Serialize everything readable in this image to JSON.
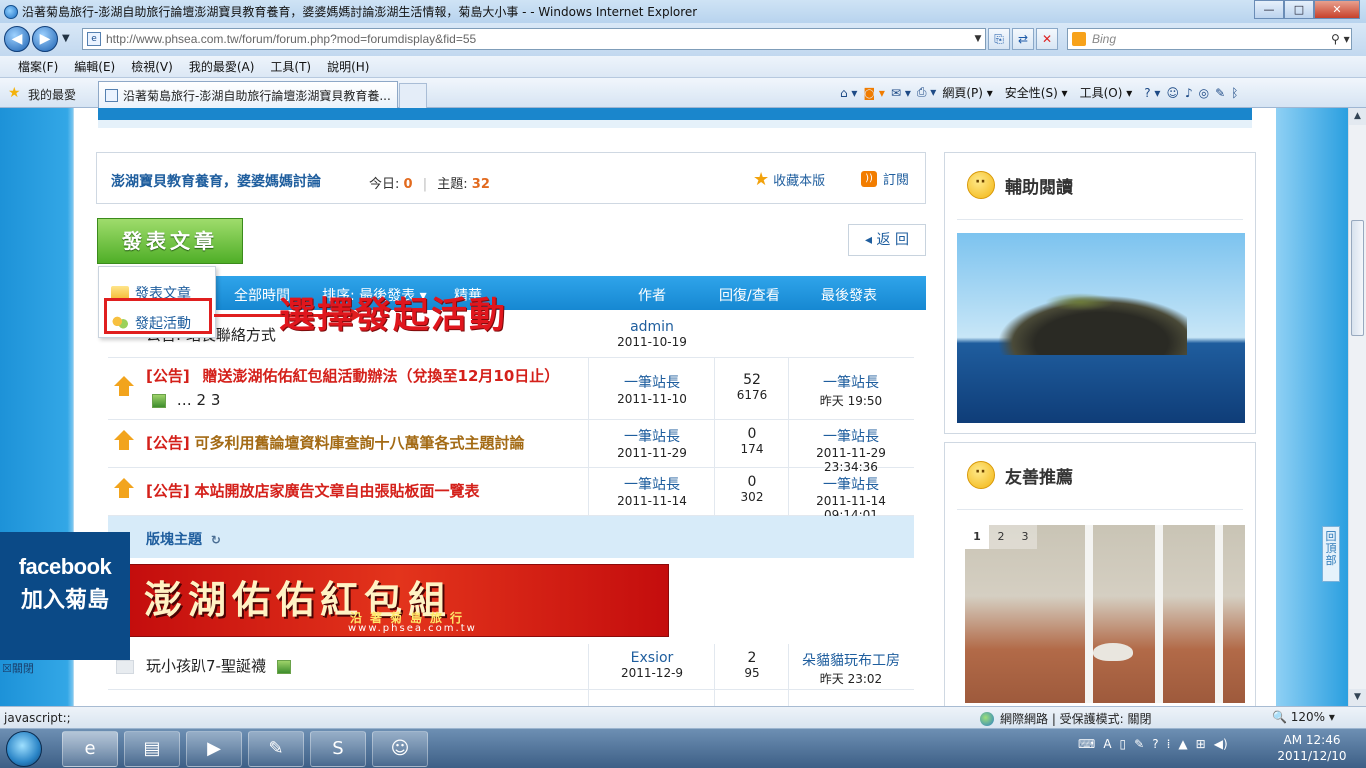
{
  "window": {
    "title": "沿著菊島旅行-澎湖自助旅行論壇澎湖寶貝教育養育，婆婆媽媽討論澎湖生活情報，菊島大小事 - - Windows Internet Explorer",
    "minimize": "—",
    "maximize": "□",
    "close": "✕"
  },
  "address": {
    "url": "http://www.phsea.com.tw/forum/forum.php?mod=forumdisplay&fid=55",
    "search_placeholder": "Bing"
  },
  "menu": [
    "檔案(F)",
    "編輯(E)",
    "檢視(V)",
    "我的最愛(A)",
    "工具(T)",
    "說明(H)"
  ],
  "favbar": {
    "favorites_label": "我的最愛",
    "tab_title": "沿著菊島旅行-澎湖自助旅行論壇澎湖寶貝教育養...",
    "commands": [
      "網頁(P) ▾",
      "安全性(S) ▾",
      "工具(O) ▾"
    ]
  },
  "forum": {
    "title": "澎湖寶貝教育養育，婆婆媽媽討論",
    "today_label": "今日:",
    "today_value": "0",
    "topics_label": "主題:",
    "topics_value": "32",
    "favorite_label": "收藏本版",
    "subscribe_label": "訂閱",
    "post_button": "發表文章",
    "back_button": "◂ 返 回"
  },
  "dropdown": {
    "item1": "發表文章",
    "item2": "發起活動"
  },
  "annotation": "選擇發起活動",
  "table_header": {
    "time": "全部時間",
    "sort": "排序: 最後發表 ▾",
    "digest": "精華",
    "author": "作者",
    "replies": "回復/查看",
    "last": "最後發表"
  },
  "rows": {
    "r0": {
      "title": "公告: 站長聯絡方式",
      "author": "admin",
      "date": "2011-10-19"
    },
    "r1": {
      "tag": "[公告]",
      "title": "贈送澎湖佑佑紅包組活動辦法（兌換至12月10日止）",
      "pages": "… 2  3",
      "author": "一筆站長",
      "date": "2011-11-10",
      "replies": "52",
      "views": "6176",
      "last_user": "一筆站長",
      "last_time": "昨天 19:50"
    },
    "r2": {
      "tag": "[公告]",
      "title": "可多利用舊論壇資料庫查詢十八萬筆各式主題討論",
      "author": "一筆站長",
      "date": "2011-11-29",
      "replies": "0",
      "views": "174",
      "last_user": "一筆站長",
      "last_time": "2011-11-29 23:34:36"
    },
    "r3": {
      "tag": "[公告]",
      "title": "本站開放店家廣告文章自由張貼板面一覽表",
      "author": "一筆站長",
      "date": "2011-11-14",
      "replies": "0",
      "views": "302",
      "last_user": "一筆站長",
      "last_time": "2011-11-14 09:14:01"
    },
    "r4": {
      "title": "玩小孩趴7-聖誕襪",
      "author": "Exsior",
      "date": "2011-12-9",
      "replies": "2",
      "views": "95",
      "last_user": "朵貓貓玩布工房",
      "last_time": "昨天 23:02"
    }
  },
  "section": {
    "title": "版塊主題"
  },
  "banner": {
    "main": "澎湖佑佑紅包組",
    "sub": "沿著菊島旅行",
    "url": "www.phsea.com.tw"
  },
  "sidebar": {
    "reading_title": "輔助閱讀",
    "recommend_title": "友善推薦",
    "pager": [
      "1",
      "2",
      "3"
    ]
  },
  "facebook": {
    "logo": "facebook",
    "join": "加入菊島",
    "close": "☒關閉"
  },
  "back_to_top": "回頂部",
  "status": {
    "left": "javascript:;",
    "zone": "網際網路 | 受保護模式: 關閉",
    "zoom": "🔍 120%  ▾"
  },
  "clock": {
    "time": "AM 12:46",
    "date": "2011/12/10"
  },
  "colors": {
    "accent_blue": "#1688d2",
    "sticky_red": "#d4201a",
    "post_green": "#4fae27"
  }
}
